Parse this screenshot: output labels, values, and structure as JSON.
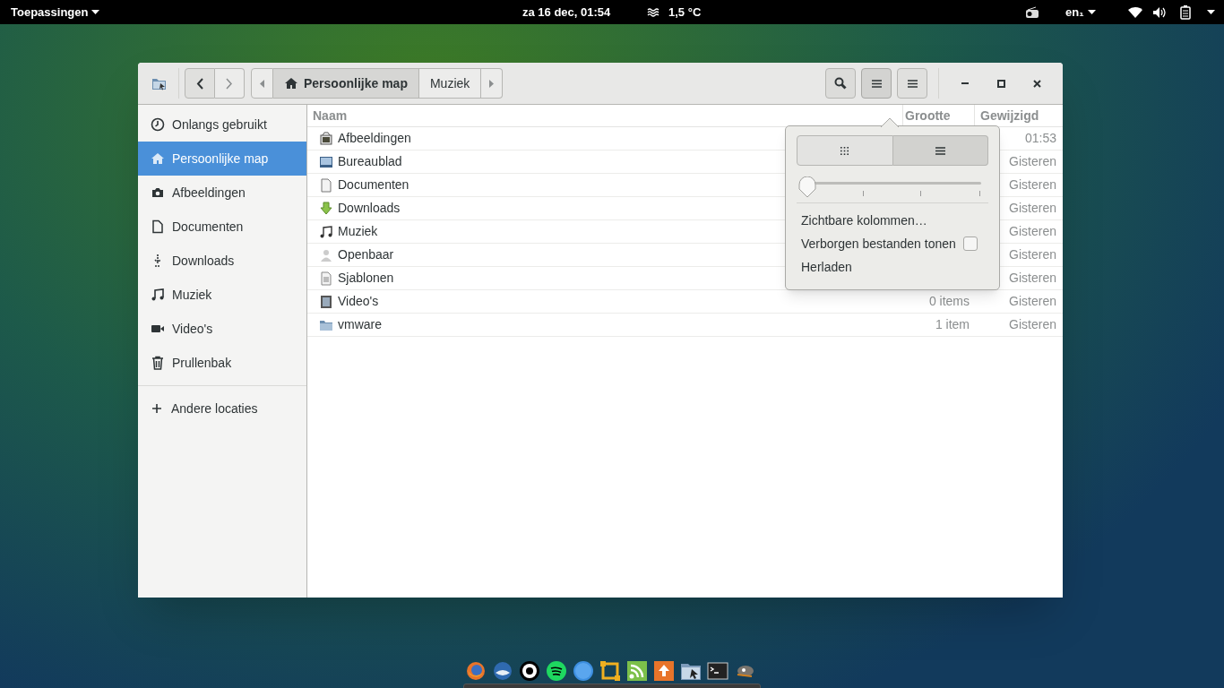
{
  "top_bar": {
    "applications_menu": "Toepassingen",
    "clock": "za 16 dec, 01:54",
    "weather": "1,5 °C",
    "keyboard_layout": "en₁"
  },
  "window": {
    "breadcrumbs": [
      {
        "label": "Persoonlijke map",
        "selected": true
      },
      {
        "label": "Muziek",
        "selected": false
      }
    ],
    "sidebar": {
      "items": [
        {
          "label": "Onlangs gebruikt",
          "selected": false
        },
        {
          "label": "Persoonlijke map",
          "selected": true
        },
        {
          "label": "Afbeeldingen",
          "selected": false
        },
        {
          "label": "Documenten",
          "selected": false
        },
        {
          "label": "Downloads",
          "selected": false
        },
        {
          "label": "Muziek",
          "selected": false
        },
        {
          "label": "Video's",
          "selected": false
        },
        {
          "label": "Prullenbak",
          "selected": false
        }
      ],
      "other_locations": "Andere locaties"
    },
    "columns": [
      "Naam",
      "Grootte",
      "Gewijzigd"
    ],
    "rows": [
      {
        "name": "Afbeeldingen",
        "modified": "01:53"
      },
      {
        "name": "Bureaublad",
        "modified": "Gisteren"
      },
      {
        "name": "Documenten",
        "modified": "Gisteren"
      },
      {
        "name": "Downloads",
        "modified": "Gisteren"
      },
      {
        "name": "Muziek",
        "modified": "Gisteren"
      },
      {
        "name": "Openbaar",
        "modified": "Gisteren"
      },
      {
        "name": "Sjablonen",
        "modified": "Gisteren"
      },
      {
        "name": "Video's",
        "size": "0 items",
        "modified": "Gisteren"
      },
      {
        "name": "vmware",
        "size": "1 item",
        "modified": "Gisteren"
      }
    ],
    "view_popover": {
      "view_modes": [
        {
          "kind": "grid",
          "selected": false
        },
        {
          "kind": "list",
          "selected": true
        }
      ],
      "zoom": {
        "level": 0
      },
      "items": [
        {
          "kind": "link",
          "label": "Zichtbare kolommen…"
        },
        {
          "kind": "check",
          "label": "Verborgen bestanden tonen",
          "checked": false
        },
        {
          "kind": "link",
          "label": "Herladen"
        }
      ]
    }
  }
}
